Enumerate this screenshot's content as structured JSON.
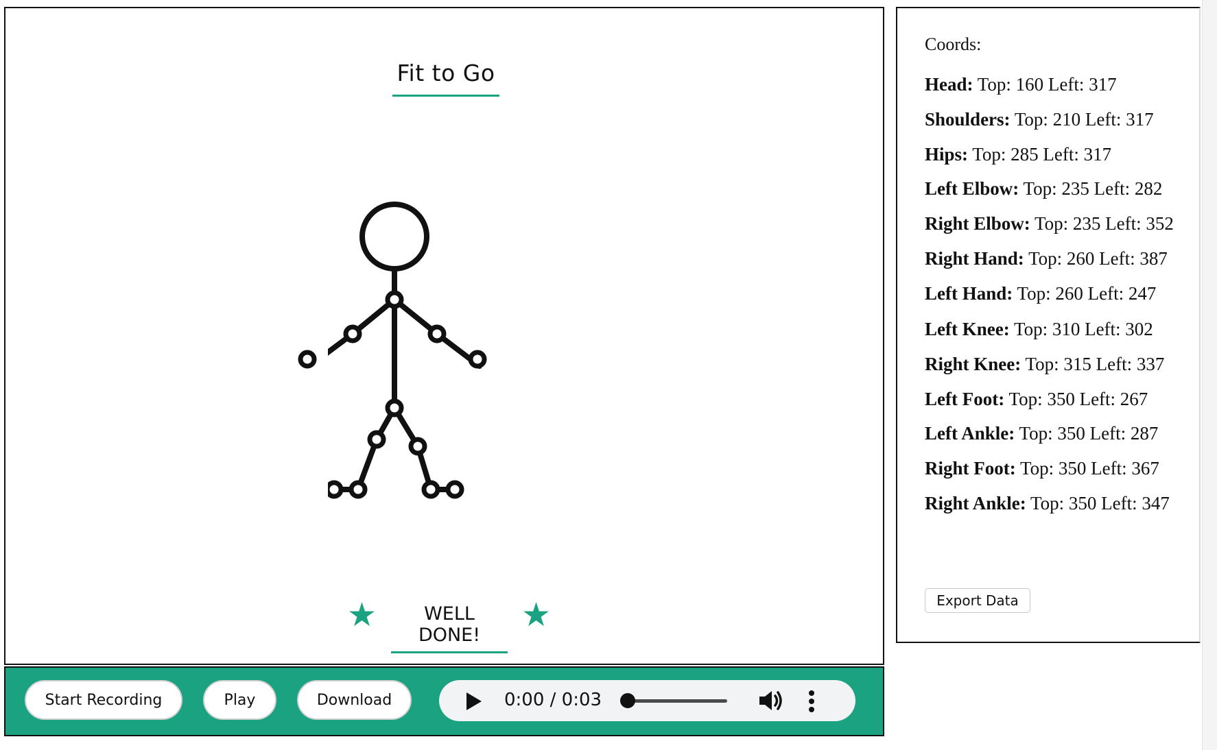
{
  "app": {
    "title": "Fit to Go",
    "message": "WELL DONE!"
  },
  "icons": {
    "star": "star-icon",
    "play": "play-icon",
    "volume": "volume-icon",
    "more": "more-vertical-icon"
  },
  "colors": {
    "accent": "#1aa281",
    "figure": "#111111",
    "audio_bg": "#f1f3f4"
  },
  "controls": {
    "start_recording": "Start Recording",
    "play": "Play",
    "download": "Download",
    "audio": {
      "time": "0:00 / 0:03",
      "progress": 0
    }
  },
  "coords": {
    "label": "Coords:",
    "items": [
      {
        "name": "Head:",
        "value": "Top: 160 Left: 317"
      },
      {
        "name": "Shoulders:",
        "value": "Top: 210 Left: 317"
      },
      {
        "name": "Hips:",
        "value": "Top: 285 Left: 317"
      },
      {
        "name": "Left Elbow:",
        "value": "Top: 235 Left: 282"
      },
      {
        "name": "Right Elbow:",
        "value": "Top: 235 Left: 352"
      },
      {
        "name": "Right Hand:",
        "value": "Top: 260 Left: 387"
      },
      {
        "name": "Left Hand:",
        "value": "Top: 260 Left: 247"
      },
      {
        "name": "Left Knee:",
        "value": "Top: 310 Left: 302"
      },
      {
        "name": "Right Knee:",
        "value": "Top: 315 Left: 337"
      },
      {
        "name": "Left Foot:",
        "value": "Top: 350 Left: 267"
      },
      {
        "name": "Left Ankle:",
        "value": "Top: 350 Left: 287"
      },
      {
        "name": "Right Foot:",
        "value": "Top: 350 Left: 367"
      },
      {
        "name": "Right Ankle:",
        "value": "Top: 350 Left: 347"
      }
    ],
    "export_label": "Export Data"
  }
}
